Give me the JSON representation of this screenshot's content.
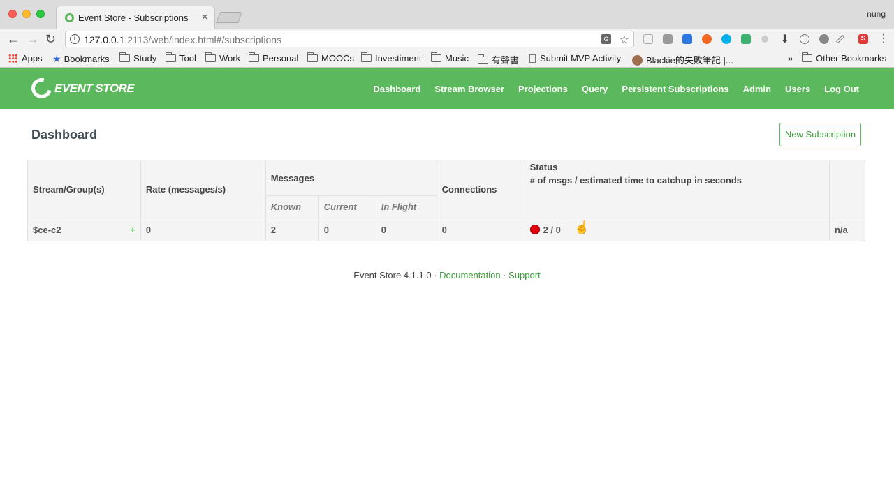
{
  "browser": {
    "tab_title": "Event Store - Subscriptions",
    "tab_close": "×",
    "profile": "nung",
    "url_host": "127.0.0.1",
    "url_rest": ":2113/web/index.html#/subscriptions",
    "bookmarks": [
      {
        "label": "Apps",
        "icon": "apps-icon"
      },
      {
        "label": "Bookmarks",
        "icon": "star-icon"
      },
      {
        "label": "Study",
        "icon": "folder-icon"
      },
      {
        "label": "Tool",
        "icon": "folder-icon"
      },
      {
        "label": "Work",
        "icon": "folder-icon"
      },
      {
        "label": "Personal",
        "icon": "folder-icon"
      },
      {
        "label": "MOOCs",
        "icon": "folder-icon"
      },
      {
        "label": "Investiment",
        "icon": "folder-icon"
      },
      {
        "label": "Music",
        "icon": "folder-icon"
      },
      {
        "label": "有聲書",
        "icon": "folder-icon"
      },
      {
        "label": "Submit MVP Activity",
        "icon": "page-icon"
      },
      {
        "label": "Blackie的失敗筆記 |...",
        "icon": "avatar-icon"
      }
    ],
    "bookmarks_overflow": "»",
    "other_bookmarks": "Other Bookmarks"
  },
  "app": {
    "logo_text": "EVENT STORE",
    "nav": [
      "Dashboard",
      "Stream Browser",
      "Projections",
      "Query",
      "Persistent Subscriptions",
      "Admin",
      "Users",
      "Log Out"
    ]
  },
  "page": {
    "title": "Dashboard",
    "new_subscription": "New Subscription"
  },
  "table": {
    "headers": {
      "stream": "Stream/Group(s)",
      "rate": "Rate (messages/s)",
      "messages": "Messages",
      "connections": "Connections",
      "status_line1": "Status",
      "status_line2": "# of msgs / estimated time to catchup in seconds",
      "known": "Known",
      "current": "Current",
      "in_flight": "In Flight"
    },
    "rows": [
      {
        "stream": "$ce-c2",
        "expand": "+",
        "rate": "0",
        "known": "2",
        "current": "0",
        "in_flight": "0",
        "connections": "0",
        "status": "2 / 0",
        "status_color": "#e3000f",
        "extra": "n/a"
      }
    ]
  },
  "footer": {
    "version": "Event Store 4.1.1.0",
    "sep": " · ",
    "documentation": "Documentation",
    "support": "Support"
  },
  "colors": {
    "brand_green": "#5cb85c"
  }
}
